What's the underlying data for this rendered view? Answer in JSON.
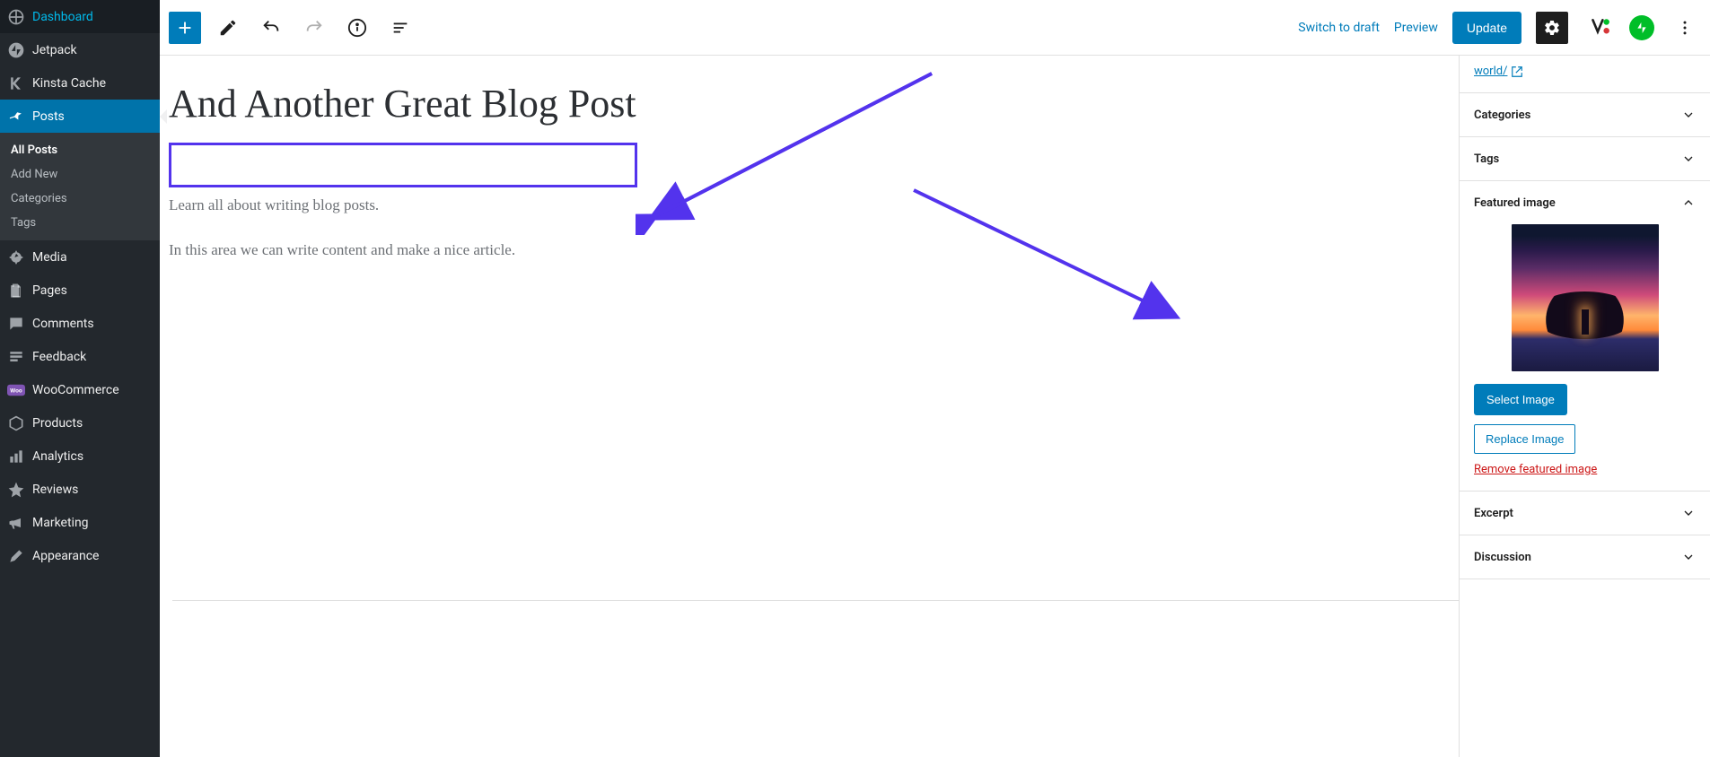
{
  "sidebar": {
    "items": [
      {
        "icon": "dashboard",
        "label": "Dashboard"
      },
      {
        "icon": "jetpack",
        "label": "Jetpack"
      },
      {
        "icon": "kinsta",
        "label": "Kinsta Cache"
      },
      {
        "icon": "pin",
        "label": "Posts",
        "active": true
      },
      {
        "icon": "media",
        "label": "Media"
      },
      {
        "icon": "pages",
        "label": "Pages"
      },
      {
        "icon": "comments",
        "label": "Comments"
      },
      {
        "icon": "feedback",
        "label": "Feedback"
      },
      {
        "icon": "woo",
        "label": "WooCommerce"
      },
      {
        "icon": "products",
        "label": "Products"
      },
      {
        "icon": "analytics",
        "label": "Analytics"
      },
      {
        "icon": "reviews",
        "label": "Reviews"
      },
      {
        "icon": "marketing",
        "label": "Marketing"
      },
      {
        "icon": "appearance",
        "label": "Appearance"
      }
    ],
    "submenu": [
      "All Posts",
      "Add New",
      "Categories",
      "Tags"
    ],
    "submenu_current": "All Posts"
  },
  "topbar": {
    "switch_draft": "Switch to draft",
    "preview": "Preview",
    "update": "Update"
  },
  "post": {
    "title": "And Another Great Blog Post",
    "para1": "Learn all about writing blog posts.",
    "para2": "In this area we can write content and make a nice article."
  },
  "settings": {
    "permalink_tail": "world/",
    "categories": "Categories",
    "tags": "Tags",
    "featured_image": "Featured image",
    "select_image": "Select Image",
    "replace_image": "Replace Image",
    "remove_image": "Remove featured image",
    "excerpt": "Excerpt",
    "discussion": "Discussion"
  },
  "colors": {
    "accent": "#007cba",
    "highlight": "#5333ed"
  }
}
